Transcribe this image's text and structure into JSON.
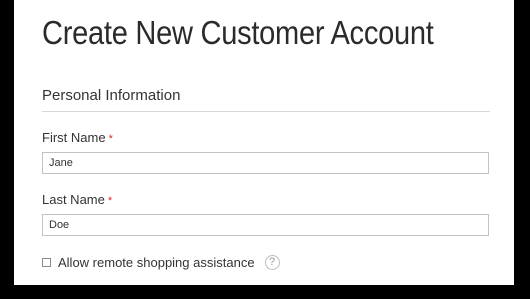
{
  "page": {
    "title": "Create New Customer Account"
  },
  "personal_info": {
    "section_title": "Personal Information",
    "first_name": {
      "label": "First Name",
      "required_marker": "*",
      "value": "Jane"
    },
    "last_name": {
      "label": "Last Name",
      "required_marker": "*",
      "value": "Doe"
    },
    "remote_assistance": {
      "label": "Allow remote shopping assistance",
      "checked": false,
      "help_glyph": "?"
    }
  },
  "colors": {
    "required": "#e02b27",
    "border": "#c2c2c2",
    "frame": "#000000"
  },
  "icons": {
    "help": "question-circle-icon"
  }
}
